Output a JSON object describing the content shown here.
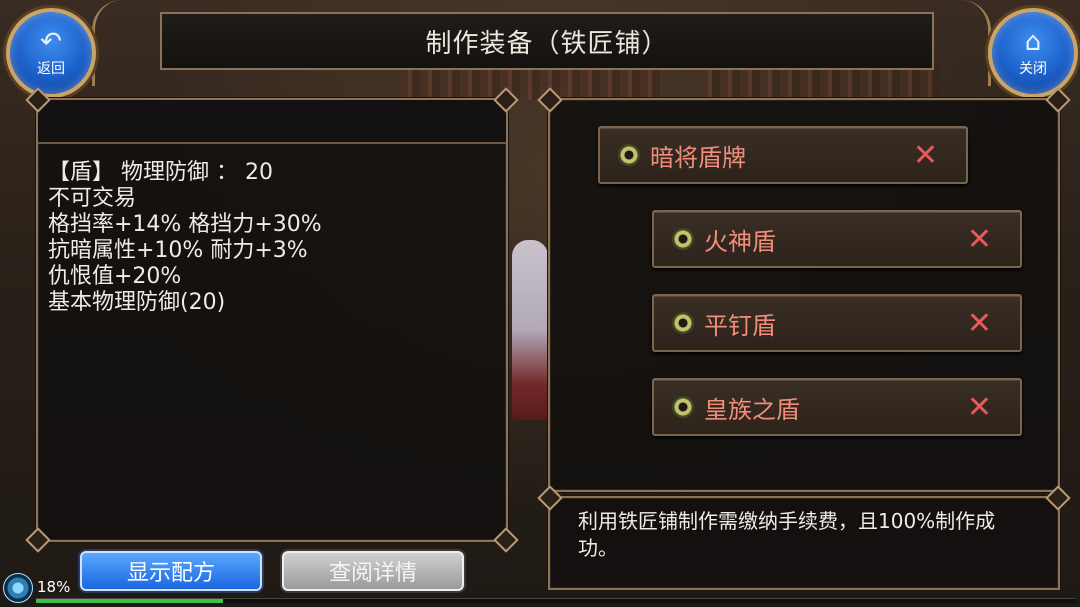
{
  "header": {
    "title": "制作装备（铁匠铺）",
    "back_button": {
      "label": "返回",
      "icon": "back-arrow-icon"
    },
    "close_button": {
      "label": "关闭",
      "icon": "home-icon"
    }
  },
  "item_stats": {
    "lines": [
      "【盾】 物理防御 ：  20",
      "不可交易",
      "格挡率+14% 格挡力+30%",
      "抗暗属性+10% 耐力+3%",
      "仇恨值+20%",
      "基本物理防御(20)"
    ]
  },
  "recipes": [
    {
      "name": "暗将盾牌",
      "icon": "gem-icon",
      "remove_icon": "x-icon"
    },
    {
      "name": "火神盾",
      "icon": "gem-icon",
      "remove_icon": "x-icon"
    },
    {
      "name": "平钉盾",
      "icon": "gem-icon",
      "remove_icon": "x-icon"
    },
    {
      "name": "皇族之盾",
      "icon": "gem-icon",
      "remove_icon": "x-icon"
    }
  ],
  "info": {
    "text": "利用铁匠铺制作需缴纳手续费，且100%制作成功。"
  },
  "buttons": {
    "show_recipe": "显示配方",
    "view_detail": "查阅详情"
  },
  "status": {
    "percent": "18%",
    "exp_fraction": 0.18
  },
  "colors": {
    "recipe_text": "#f08e7a",
    "remove_x": "#e85a5a",
    "primary_button": "#1a66e0",
    "disabled_button": "#9a9a9a",
    "frame_gold": "#8a7358"
  }
}
